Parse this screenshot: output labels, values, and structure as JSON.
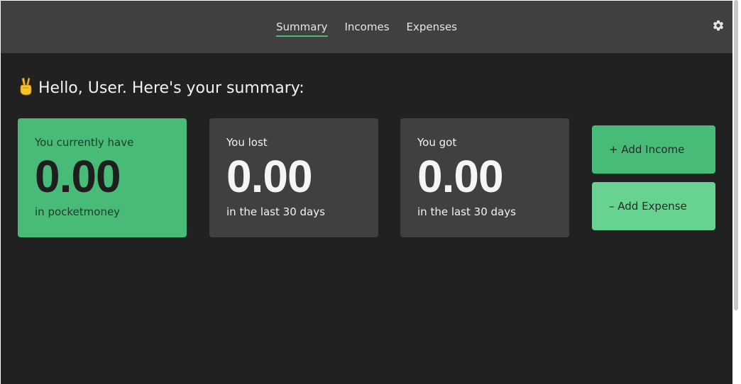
{
  "nav": {
    "tabs": [
      {
        "label": "Summary",
        "active": true
      },
      {
        "label": "Incomes",
        "active": false
      },
      {
        "label": "Expenses",
        "active": false
      }
    ],
    "settings_icon": "gear-icon"
  },
  "greeting": {
    "emoji_icon": "victory-hand-icon",
    "text": "Hello, User. Here's your summary:"
  },
  "cards": {
    "balance": {
      "label": "You currently have",
      "value": "0.00",
      "sub": "in pocketmoney"
    },
    "lost": {
      "label": "You lost",
      "value": "0.00",
      "sub": "in the last 30 days"
    },
    "got": {
      "label": "You got",
      "value": "0.00",
      "sub": "in the last 30 days"
    }
  },
  "actions": {
    "add_income": "+ Add Income",
    "add_expense": "– Add Expense"
  },
  "colors": {
    "accent": "#48bb78",
    "accent_light": "#68d391",
    "background": "#212121",
    "surface": "#404040"
  }
}
